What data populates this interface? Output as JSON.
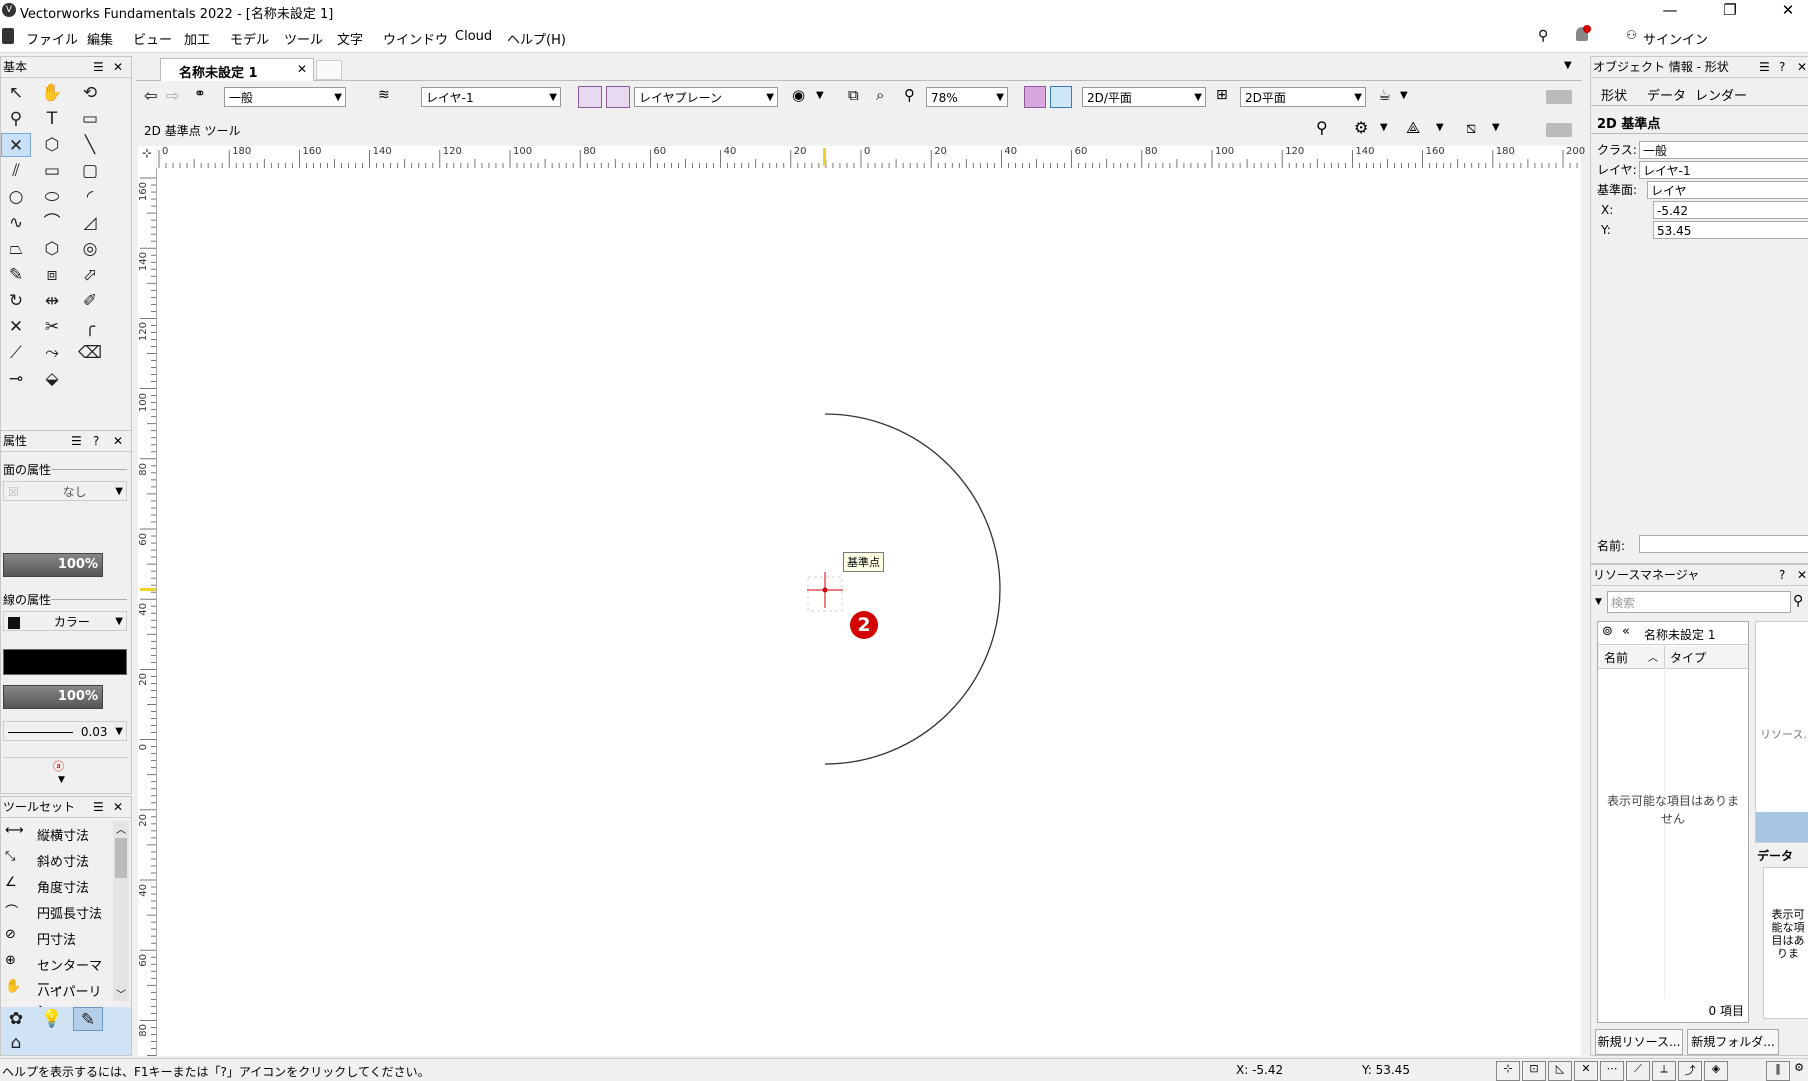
{
  "window": {
    "title": "Vectorworks Fundamentals 2022 - [名称未設定 1]",
    "minimize": "—",
    "restore": "❐",
    "close": "✕"
  },
  "menu": [
    "ファイル",
    "編集",
    "ビュー",
    "加工",
    "モデル",
    "ツール",
    "文字",
    "ウインドウ",
    "Cloud",
    "ヘルプ(H)"
  ],
  "menu_right": {
    "signin": "サインイン"
  },
  "document_tab": {
    "label": "名称未設定 1",
    "close": "✕"
  },
  "view_bar": {
    "class": "一般",
    "layer": "レイヤ-1",
    "plane": "レイヤプレーン",
    "zoom": "78%",
    "view": "2D/平面",
    "render": "2D平面"
  },
  "tool_mode": {
    "label": "2D 基準点 ツール"
  },
  "basic_palette": {
    "title": "基本"
  },
  "attributes": {
    "title": "属性",
    "fill_label": "面の属性",
    "fill_value": "なし",
    "fill_opacity": "100%",
    "pen_label": "線の属性",
    "pen_value": "カラー",
    "pen_opacity": "100%",
    "line_weight": "0.03"
  },
  "toolset": {
    "title": "ツールセット",
    "items": [
      "縦横寸法",
      "斜め寸法",
      "角度寸法",
      "円弧長寸法",
      "円寸法",
      "センターマー...",
      "ハイパーリン..."
    ]
  },
  "ruler": {
    "h_labels": [
      "0",
      "180",
      "160",
      "140",
      "120",
      "100",
      "80",
      "60",
      "40",
      "20",
      "0",
      "20",
      "40",
      "60",
      "80",
      "100",
      "120",
      "140",
      "160",
      "180",
      "200"
    ],
    "v_labels": [
      "160",
      "140",
      "120",
      "100",
      "80",
      "60",
      "40",
      "20",
      "0",
      "20",
      "40",
      "60",
      "80"
    ]
  },
  "canvas": {
    "tooltip": "基準点",
    "marker": "2"
  },
  "obj_info": {
    "title": "オブジェクト 情報 - 形状",
    "tabs": [
      "形状",
      "データ",
      "レンダー"
    ],
    "object_type": "2D 基準点",
    "class_label": "クラス:",
    "class_value": "一般",
    "layer_label": "レイヤ:",
    "layer_value": "レイヤ-1",
    "plane_label": "基準面:",
    "plane_value": "レイヤ",
    "x_label": "X:",
    "x_value": "-5.42",
    "y_label": "Y:",
    "y_value": "53.45",
    "name_label": "名前:"
  },
  "resource_manager": {
    "title": "リソースマネージャ",
    "search_placeholder": "検索",
    "file": "名称未設定 1",
    "col_name": "名前",
    "col_type": "タイプ",
    "empty": "表示可能な項目はありません",
    "count": "0 項目",
    "side_label": "リソース...",
    "data_label": "データ",
    "data_empty": "表示可能な項目はありま",
    "new_resource": "新規リソース...",
    "new_folder": "新規フォルダ..."
  },
  "status": {
    "help": "ヘルプを表示するには、F1キーまたは「?」アイコンをクリックしてください。",
    "x": "X: -5.42",
    "y": "Y: 53.45"
  },
  "colors": {
    "accent": "#d40000",
    "selection": "#c8e0f8"
  }
}
